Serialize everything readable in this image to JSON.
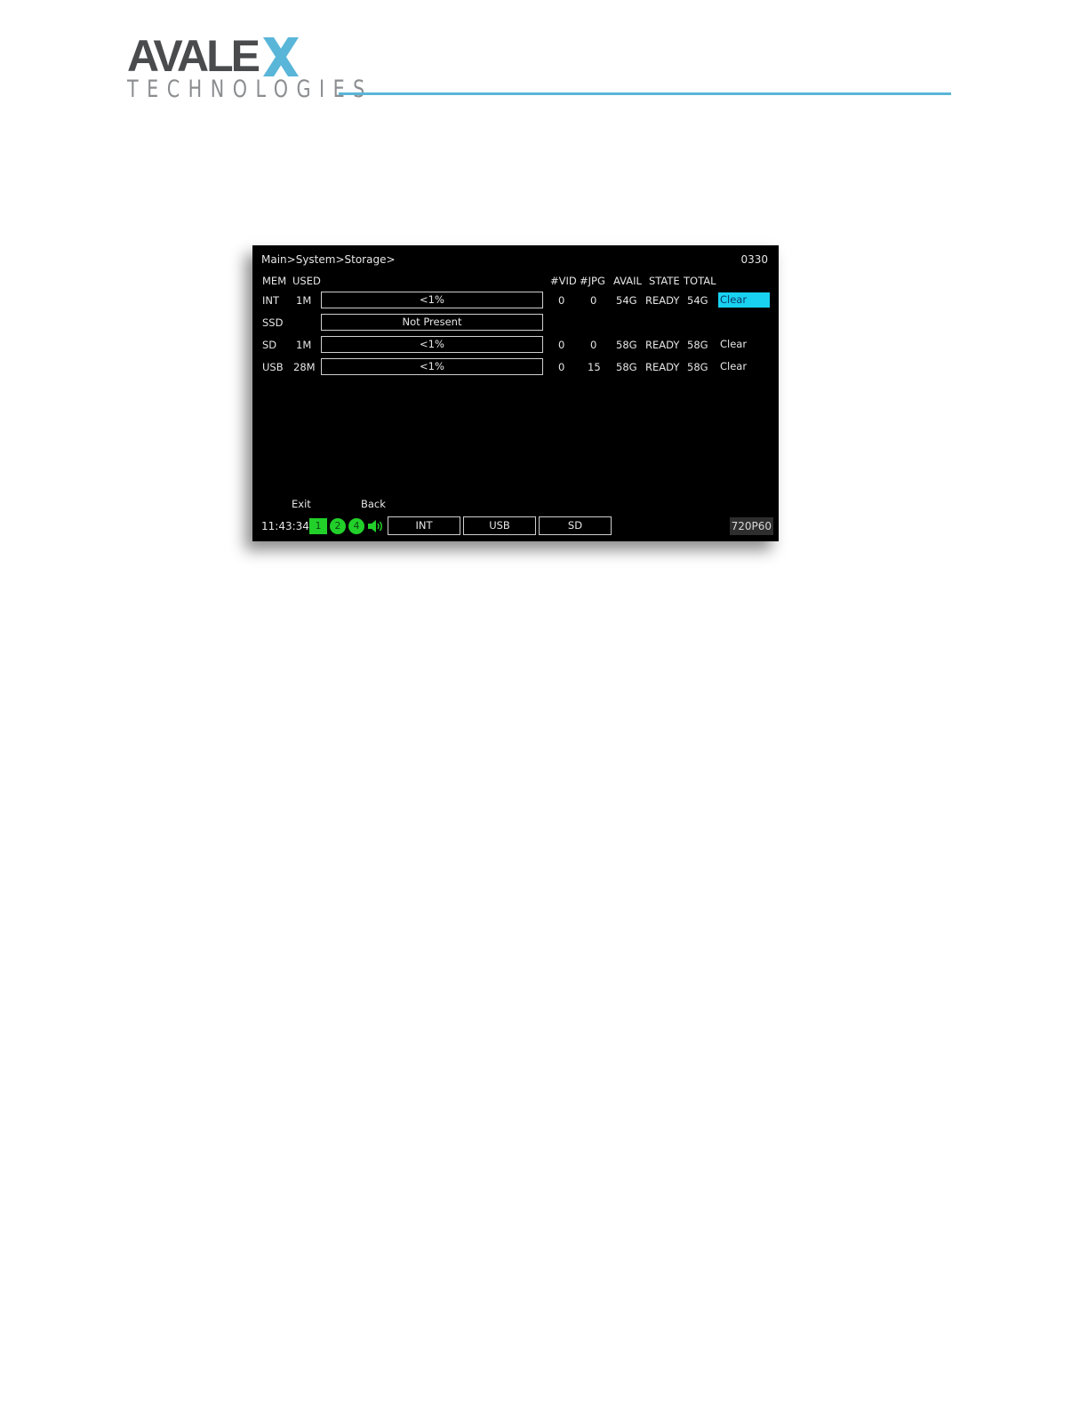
{
  "logo": {
    "name": "AVALE",
    "x_letter": "X",
    "sub": "TECHNOLOGIES"
  },
  "colors": {
    "accent_rule": "#5ab6d8",
    "selected": "#19d2f2",
    "indicator": "#22d02a"
  },
  "screen": {
    "breadcrumb": "Main>System>Storage>",
    "screen_id": "0330",
    "columns": {
      "mem": "MEM",
      "used": "USED",
      "vid": "#VID",
      "jpg": "#JPG",
      "avail": "AVAIL",
      "state": "STATE",
      "total": "TOTAL"
    },
    "rows": [
      {
        "mem": "INT",
        "used": "1M",
        "bar": "<1%",
        "vid": "0",
        "jpg": "0",
        "avail": "54G",
        "state": "READY",
        "total": "54G",
        "action": "Clear"
      },
      {
        "mem": "SSD",
        "used": "",
        "bar": "Not Present",
        "vid": "",
        "jpg": "",
        "avail": "",
        "state": "",
        "total": "",
        "action": ""
      },
      {
        "mem": "SD",
        "used": "1M",
        "bar": "<1%",
        "vid": "0",
        "jpg": "0",
        "avail": "58G",
        "state": "READY",
        "total": "58G",
        "action": "Clear"
      },
      {
        "mem": "USB",
        "used": "28M",
        "bar": "<1%",
        "vid": "0",
        "jpg": "15",
        "avail": "58G",
        "state": "READY",
        "total": "58G",
        "action": "Clear"
      }
    ],
    "hints": {
      "exit": "Exit",
      "back": "Back"
    },
    "status": {
      "clock": "11:43:34",
      "channels": [
        "1",
        "2",
        "4"
      ],
      "speaker_icon": "speaker-icon",
      "tabs": [
        "INT",
        "USB",
        "SD"
      ],
      "resolution": "720P60"
    }
  }
}
